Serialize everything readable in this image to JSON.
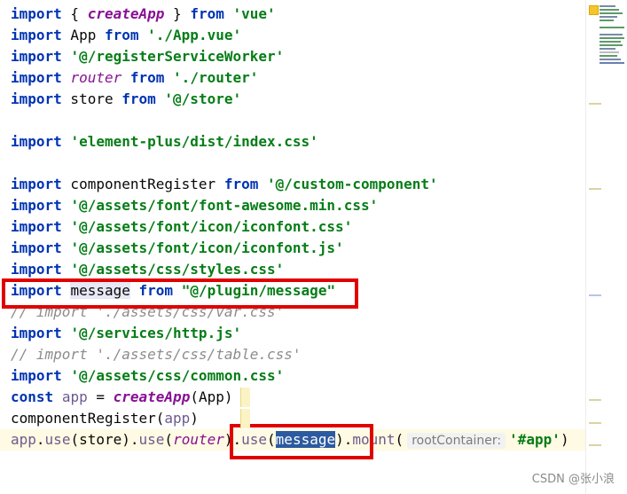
{
  "editor": {
    "lines": [
      {
        "segs": [
          [
            "kw",
            "import"
          ],
          [
            "plain",
            " { "
          ],
          [
            "fn",
            "createApp"
          ],
          [
            "plain",
            " } "
          ],
          [
            "kw",
            "from"
          ],
          [
            "plain",
            " "
          ],
          [
            "str",
            "'vue'"
          ]
        ]
      },
      {
        "segs": [
          [
            "kw",
            "import"
          ],
          [
            "plain",
            " App "
          ],
          [
            "kw",
            "from"
          ],
          [
            "plain",
            " "
          ],
          [
            "str",
            "'./App.vue'"
          ]
        ]
      },
      {
        "segs": [
          [
            "kw",
            "import"
          ],
          [
            "plain",
            " "
          ],
          [
            "str",
            "'@/registerServiceWorker'"
          ]
        ]
      },
      {
        "segs": [
          [
            "kw",
            "import"
          ],
          [
            "plain",
            " "
          ],
          [
            "ital",
            "router"
          ],
          [
            "plain",
            " "
          ],
          [
            "kw",
            "from"
          ],
          [
            "plain",
            " "
          ],
          [
            "str",
            "'./router'"
          ]
        ]
      },
      {
        "segs": [
          [
            "kw",
            "import"
          ],
          [
            "plain",
            " store "
          ],
          [
            "kw",
            "from"
          ],
          [
            "plain",
            " "
          ],
          [
            "str",
            "'@/store'"
          ]
        ]
      },
      {
        "segs": []
      },
      {
        "segs": [
          [
            "kw",
            "import"
          ],
          [
            "plain",
            " "
          ],
          [
            "str",
            "'element-plus/dist/index.css'"
          ]
        ]
      },
      {
        "segs": []
      },
      {
        "segs": [
          [
            "kw",
            "import"
          ],
          [
            "plain",
            " componentRegister "
          ],
          [
            "kw",
            "from"
          ],
          [
            "plain",
            " "
          ],
          [
            "str",
            "'@/custom-component'"
          ]
        ]
      },
      {
        "segs": [
          [
            "kw",
            "import"
          ],
          [
            "plain",
            " "
          ],
          [
            "str",
            "'@/assets/font/font-awesome.min.css'"
          ]
        ]
      },
      {
        "segs": [
          [
            "kw",
            "import"
          ],
          [
            "plain",
            " "
          ],
          [
            "str",
            "'@/assets/font/icon/iconfont.css'"
          ]
        ]
      },
      {
        "segs": [
          [
            "kw",
            "import"
          ],
          [
            "plain",
            " "
          ],
          [
            "str",
            "'@/assets/font/icon/iconfont.js'"
          ]
        ]
      },
      {
        "segs": [
          [
            "kw",
            "import"
          ],
          [
            "plain",
            " "
          ],
          [
            "str",
            "'@/assets/css/styles.css'"
          ]
        ]
      },
      {
        "segs": [
          [
            "kw",
            "import"
          ],
          [
            "plain",
            " "
          ],
          [
            "hl-var",
            "message"
          ],
          [
            "plain",
            " "
          ],
          [
            "kw",
            "from"
          ],
          [
            "plain",
            " "
          ],
          [
            "str",
            "\"@/plugin/message\""
          ]
        ]
      },
      {
        "segs": [
          [
            "cmt",
            "// import './assets/css/var.css'"
          ]
        ]
      },
      {
        "segs": [
          [
            "kw",
            "import"
          ],
          [
            "plain",
            " "
          ],
          [
            "str",
            "'@/services/http.js'"
          ]
        ]
      },
      {
        "segs": [
          [
            "cmt",
            "// import './assets/css/table.css'"
          ]
        ]
      },
      {
        "segs": [
          [
            "kw",
            "import"
          ],
          [
            "plain",
            " "
          ],
          [
            "str",
            "'@/assets/css/common.css'"
          ]
        ]
      },
      {
        "segs": [
          [
            "kw",
            "const"
          ],
          [
            "plain",
            " "
          ],
          [
            "var",
            "app"
          ],
          [
            "plain",
            " = "
          ],
          [
            "fn",
            "createApp"
          ],
          [
            "plain",
            "(App)"
          ]
        ]
      },
      {
        "segs": [
          [
            "plain",
            "componentRegister("
          ],
          [
            "var",
            "app"
          ],
          [
            "plain",
            ")"
          ]
        ]
      },
      {
        "segs": [
          [
            "var",
            "app"
          ],
          [
            "plain",
            "."
          ],
          [
            "var",
            "use"
          ],
          [
            "plain",
            "(store)."
          ],
          [
            "var",
            "use"
          ],
          [
            "plain",
            "("
          ],
          [
            "ital",
            "router"
          ],
          [
            "plain",
            ")."
          ],
          [
            "var",
            "use"
          ],
          [
            "plain",
            "("
          ],
          [
            "hl-sel",
            "message"
          ],
          [
            "plain",
            ")."
          ],
          [
            "var",
            "mount"
          ],
          [
            "plain",
            "("
          ],
          [
            "hint",
            "rootContainer:"
          ],
          [
            "str",
            "'#app'"
          ],
          [
            "plain",
            ")"
          ]
        ]
      }
    ]
  },
  "watermark": "CSDN @张小浪",
  "colors": {
    "keyword": "#0033b3",
    "string": "#067d17",
    "function": "#871094",
    "comment": "#8c8c8c",
    "annotation": "#e00000",
    "selection": "#2c5aa0"
  },
  "icons": {
    "warning": "warning-icon"
  }
}
